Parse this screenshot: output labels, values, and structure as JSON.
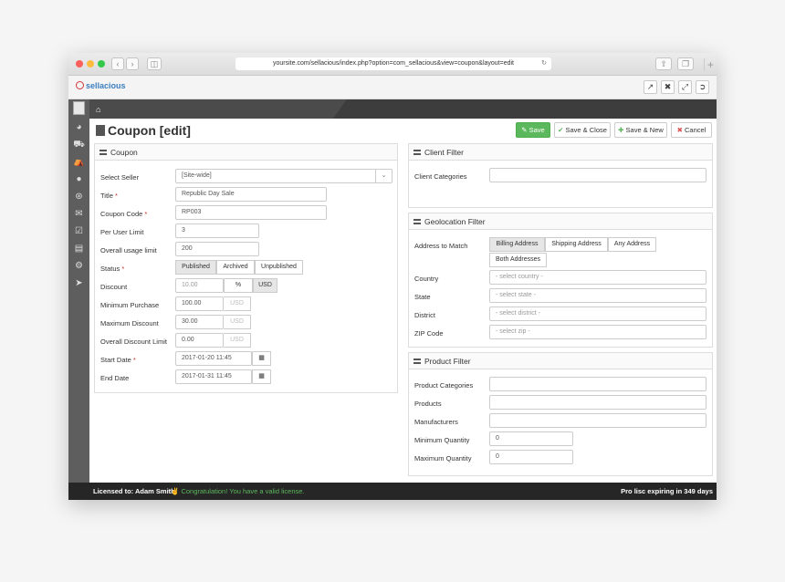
{
  "browser": {
    "url": "yoursite.com/sellacious/index.php?option=com_sellacious&view=coupon&layout=edit"
  },
  "app": {
    "logo": "sellacious"
  },
  "page": {
    "title": "Coupon [edit]"
  },
  "toolbar": {
    "save": "Save",
    "save_close": "Save & Close",
    "save_new": "Save & New",
    "cancel": "Cancel"
  },
  "coupon": {
    "heading": "Coupon",
    "select_seller_label": "Select Seller",
    "select_seller_value": "[Site-wide]",
    "title_label": "Title",
    "title_value": "Republic Day Sale",
    "code_label": "Coupon Code",
    "code_value": "RP003",
    "per_user_label": "Per User Limit",
    "per_user_value": "3",
    "overall_usage_label": "Overall usage limit",
    "overall_usage_value": "200",
    "status_label": "Status",
    "status_options": [
      "Published",
      "Archived",
      "Unpublished"
    ],
    "discount_label": "Discount",
    "discount_value": "10.00",
    "discount_percent": "%",
    "discount_usd": "USD",
    "min_purchase_label": "Minimum Purchase",
    "min_purchase_value": "100.00",
    "min_purchase_unit": "USD",
    "max_discount_label": "Maximum Discount",
    "max_discount_value": "30.00",
    "max_discount_unit": "USD",
    "overall_discount_label": "Overall Discount Limit",
    "overall_discount_value": "0.00",
    "overall_discount_unit": "USD",
    "start_date_label": "Start Date",
    "start_date_value": "2017-01-20 11:45",
    "end_date_label": "End Date",
    "end_date_value": "2017-01-31 11:45"
  },
  "client_filter": {
    "heading": "Client Filter",
    "categories_label": "Client Categories"
  },
  "geo_filter": {
    "heading": "Geolocation Filter",
    "address_label": "Address to Match",
    "address_options": [
      "Billing Address",
      "Shipping Address",
      "Any Address",
      "Both Addresses"
    ],
    "country_label": "Country",
    "country_ph": "- select country -",
    "state_label": "State",
    "state_ph": "- select state -",
    "district_label": "District",
    "district_ph": "- select district -",
    "zip_label": "ZIP Code",
    "zip_ph": "- select zip -"
  },
  "product_filter": {
    "heading": "Product Filter",
    "categories_label": "Product Categories",
    "products_label": "Products",
    "manufacturers_label": "Manufacturers",
    "min_qty_label": "Minimum Quantity",
    "min_qty_value": "0",
    "max_qty_label": "Maximum Quantity",
    "max_qty_value": "0"
  },
  "footer": {
    "licensed": "Licensed to: Adam Smith",
    "congrats": "Congratulation! You have a valid license.",
    "expiry": "Pro lisc expiring in 349 days"
  }
}
